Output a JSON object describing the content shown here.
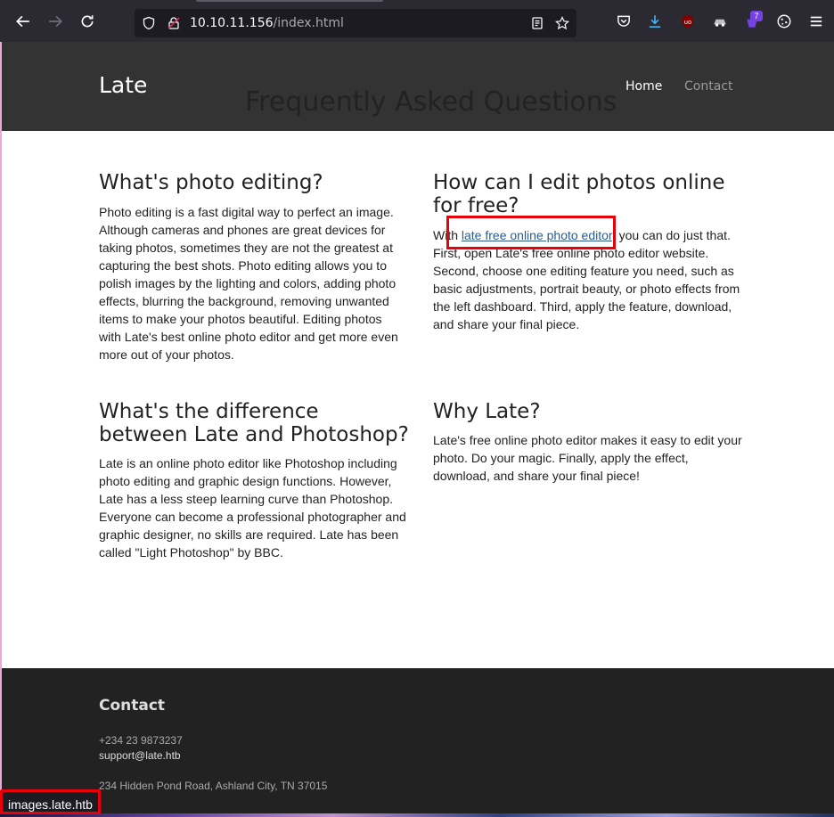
{
  "browser": {
    "url_host": "10.10.11.156",
    "url_path": "/index.html",
    "extension_badge": "7",
    "status_url": "images.late.htb"
  },
  "site": {
    "brand": "Late",
    "nav": {
      "home": "Home",
      "contact": "Contact"
    },
    "page_title": "Frequently Asked Questions"
  },
  "faq": {
    "q1": {
      "title": "What's photo editing?",
      "body": "Photo editing is a fast digital way to perfect an image. Although cameras and phones are great devices for taking photos, sometimes they are not the greatest at capturing the best shots. Photo editing allows you to polish images by the lighting and colors, adding photo effects, blurring the background, removing unwanted items to make your photos beautiful. Editing photos with Late's best online photo editor and get more even more out of your photos."
    },
    "q2": {
      "title": "How can I edit photos online for free?",
      "body_prefix": "With ",
      "link_text": "late free online photo editor",
      "body_suffix": ", you can do just that. First, open Late's free online photo editor website. Second, choose one editing feature you need, such as basic adjustments, portrait beauty, or photo effects from the left dashboard. Third, apply the feature, download, and share your final piece."
    },
    "q3": {
      "title": "What's the difference between Late and Photoshop?",
      "body": "Late is an online photo editor like Photoshop including photo editing and graphic design functions. However, Late has a less steep learning curve than Photoshop. Everyone can become a professional photographer and graphic designer, no skills are required. Late has been called \"Light Photoshop\" by BBC."
    },
    "q4": {
      "title": "Why Late?",
      "body": "Late's free online photo editor makes it easy to edit your photo. Do your magic. Finally, apply the effect, download, and share your final piece!"
    }
  },
  "footer": {
    "title": "Contact",
    "phone": "+234 23 9873237",
    "email": "support@late.htb",
    "address": "234 Hidden Pond Road, Ashland City, TN 37015"
  },
  "colors": {
    "highlight": "#e8000b",
    "header_bg": "#333333",
    "footer_bg": "#222222",
    "link": "#2a5d8f"
  }
}
